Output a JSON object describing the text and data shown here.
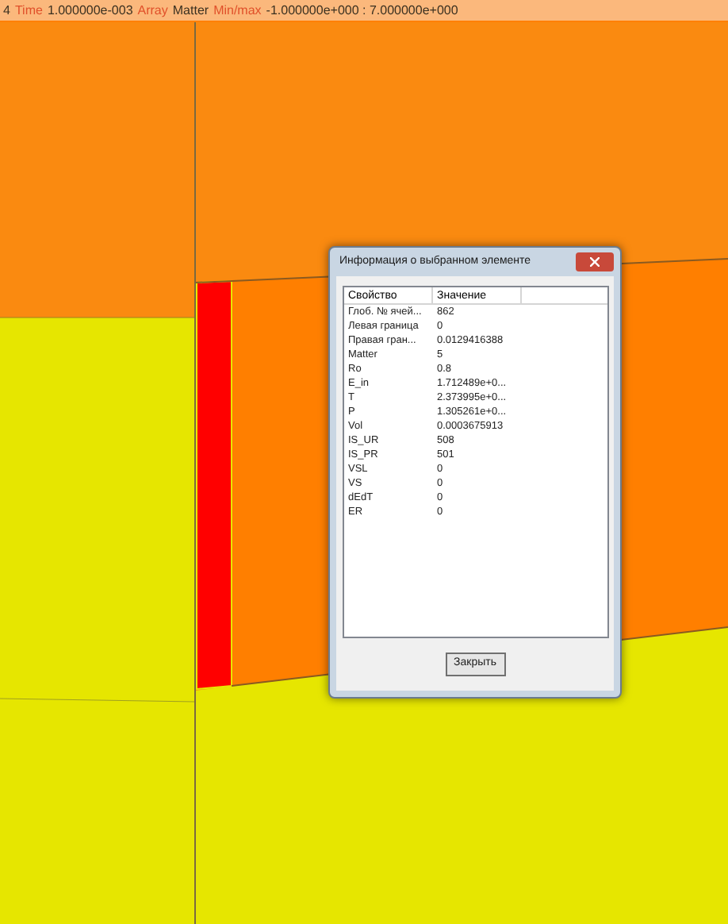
{
  "header": [
    {
      "kind": "value",
      "text": "4"
    },
    {
      "kind": "label",
      "text": "Time"
    },
    {
      "kind": "value",
      "text": "1.000000e-003"
    },
    {
      "kind": "label",
      "text": "Array"
    },
    {
      "kind": "value",
      "text": "Matter"
    },
    {
      "kind": "label",
      "text": "Min/max"
    },
    {
      "kind": "value",
      "text": "-1.000000e+000 : 7.000000e+000"
    }
  ],
  "dialog": {
    "title": "Информация о выбранном элементе",
    "columns": [
      "Свойство",
      "Значение"
    ],
    "rows": [
      [
        "Глоб. № ячей...",
        "862"
      ],
      [
        "Левая граница",
        "0"
      ],
      [
        "Правая гран...",
        "0.0129416388"
      ],
      [
        "Matter",
        "5"
      ],
      [
        "Ro",
        "0.8"
      ],
      [
        "E_in",
        "1.712489e+0..."
      ],
      [
        "T",
        "2.373995e+0..."
      ],
      [
        "P",
        "1.305261e+0..."
      ],
      [
        "Vol",
        "0.0003675913"
      ],
      [
        "IS_UR",
        "508"
      ],
      [
        "IS_PR",
        "501"
      ],
      [
        "VSL",
        "0"
      ],
      [
        "VS",
        "0"
      ],
      [
        "dEdT",
        "0"
      ],
      [
        "ER",
        "0"
      ]
    ],
    "button": "Закрыть"
  }
}
